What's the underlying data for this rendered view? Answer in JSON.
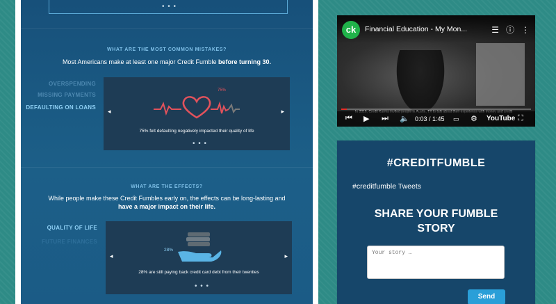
{
  "infographic": {
    "top_card_dots": "• • •",
    "mistakes": {
      "heading": "WHAT ARE THE MOST COMMON MISTAKES?",
      "text_plain": "Most Americans make at least one major Credit Fumble ",
      "text_bold": "before turning 30.",
      "tabs": [
        "OVERSPENDING",
        "MISSING PAYMENTS",
        "DEFAULTING ON LOANS"
      ],
      "active_tab": 2,
      "slide_percent": "75%",
      "slide_percent_value": 75,
      "slide_caption": "75% felt defaulting negatively impacted their quality of life",
      "slide_dots": "• • •"
    },
    "effects": {
      "heading": "WHAT ARE THE EFFECTS?",
      "text_line1": "While people make these Credit Fumbles early on, the effects can be long-lasting and",
      "text_line2_bold": "have a major impact on their life.",
      "tabs": [
        "QUALITY OF LIFE",
        "FUTURE FINANCES"
      ],
      "active_tab": 0,
      "slide_percent": "28%",
      "slide_percent_value": 28,
      "slide_caption": "28% are still paying back credit card debt from their twenties",
      "slide_dots": "• • •"
    },
    "arrow_left": "◂",
    "arrow_right": "▸",
    "colors": {
      "heart_line": "#e2525c",
      "accent_blue": "#8fd0f5",
      "hand": "#5ab4e5"
    }
  },
  "video": {
    "channel_logo": "ck",
    "title": "Financial Education - My Mon...",
    "subtitle": "In 2016, Credit Karma invited people in Austin, TX to talk about their experience with money and credit",
    "time": "0:03 / 1:45",
    "progress_fraction": 0.03,
    "brand": "YouTube",
    "icons": [
      "playlist-icon",
      "info-icon",
      "more-icon",
      "skip-back-icon",
      "play-icon",
      "skip-next-icon",
      "volume-icon",
      "captions-icon",
      "settings-icon",
      "fullscreen-icon"
    ]
  },
  "share": {
    "hashtag": "#CREDITFUMBLE",
    "tweets_link": "#creditfumble Tweets",
    "title_line1": "SHARE YOUR FUMBLE",
    "title_line2": "STORY",
    "input_placeholder": "Your story …",
    "send_label": "Send"
  }
}
